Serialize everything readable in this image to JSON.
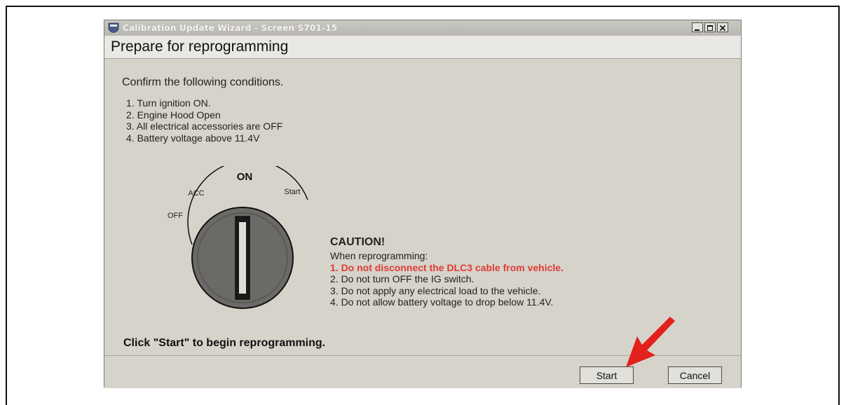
{
  "window": {
    "title": "Calibration Update Wizard - Screen S701-15"
  },
  "page": {
    "heading": "Prepare for reprogramming",
    "intro": "Confirm the following conditions.",
    "conditions": [
      "1. Turn ignition ON.",
      "2. Engine Hood Open",
      "3. All electrical accessories are OFF",
      "4. Battery voltage above 11.4V"
    ]
  },
  "key_switch": {
    "on_label": "ON",
    "acc_label": "ACC",
    "start_label": "Start",
    "off_label": "OFF"
  },
  "caution": {
    "title": "CAUTION!",
    "subtitle": "When reprogramming:",
    "items": [
      "1. Do not disconnect the DLC3 cable from vehicle.",
      "2. Do not turn OFF the IG switch.",
      "3. Do not apply any electrical load to the vehicle.",
      "4. Do not allow battery voltage to drop below 11.4V."
    ]
  },
  "instruction": "Click \"Start\" to begin reprogramming.",
  "buttons": {
    "start": "Start",
    "cancel": "Cancel"
  },
  "colors": {
    "caution_highlight": "#e03a35",
    "arrow": "#e3201b"
  }
}
